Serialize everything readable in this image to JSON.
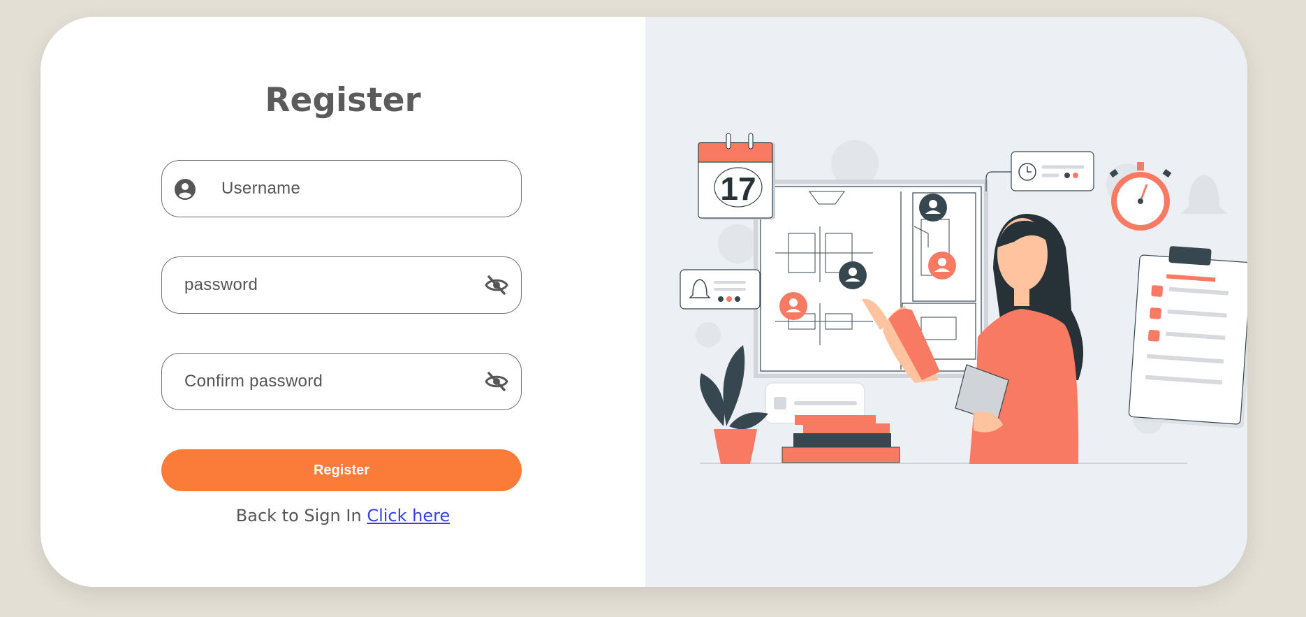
{
  "form": {
    "title": "Register",
    "username_placeholder": "Username",
    "password_placeholder": "password",
    "confirm_placeholder": "Confirm password",
    "submit_label": "Register",
    "back_text": "Back to Sign In",
    "back_link": "Click here"
  },
  "illustration": {
    "calendar_day": "17"
  },
  "colors": {
    "accent": "#fb7b38",
    "link": "#3340e6",
    "illustration_coral": "#f87a62",
    "illustration_dark": "#37474f",
    "background": "#e3dfd5"
  },
  "icons": {
    "username": "user-circle-icon",
    "password_toggle": "eye-slash-icon",
    "confirm_toggle": "eye-slash-icon"
  }
}
